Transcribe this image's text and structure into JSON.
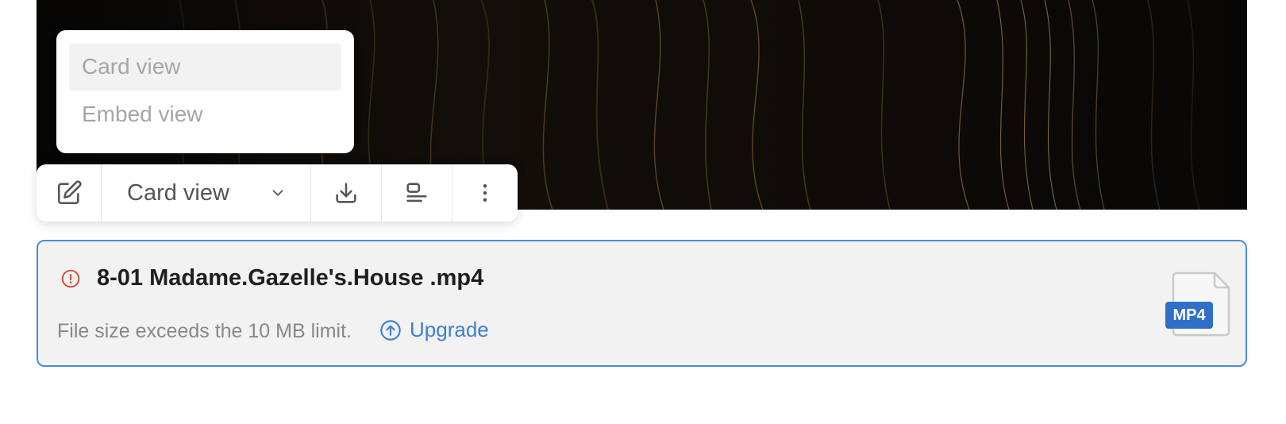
{
  "view_menu": {
    "items": [
      {
        "label": "Card view",
        "selected": true
      },
      {
        "label": "Embed view",
        "selected": false
      }
    ]
  },
  "toolbar": {
    "edit_icon": "edit-icon",
    "view_select_value": "Card view",
    "dropdown_icon": "chevron-down-icon",
    "download_icon": "download-icon",
    "align_icon": "align-left-icon",
    "more_icon": "more-vertical-icon"
  },
  "attachment": {
    "file_name": "8-01 Madame.Gazelle's.House .mp4",
    "error_icon": "alert-circle-icon",
    "error_message": "File size exceeds the 10 MB limit.",
    "upgrade_label": "Upgrade",
    "upgrade_icon": "arrow-up-circle-icon",
    "file_type_badge": "MP4"
  },
  "colors": {
    "accent": "#3b7fd4",
    "error": "#d14b3b",
    "card_border": "#4a8ddb",
    "badge": "#2f6fc9"
  }
}
